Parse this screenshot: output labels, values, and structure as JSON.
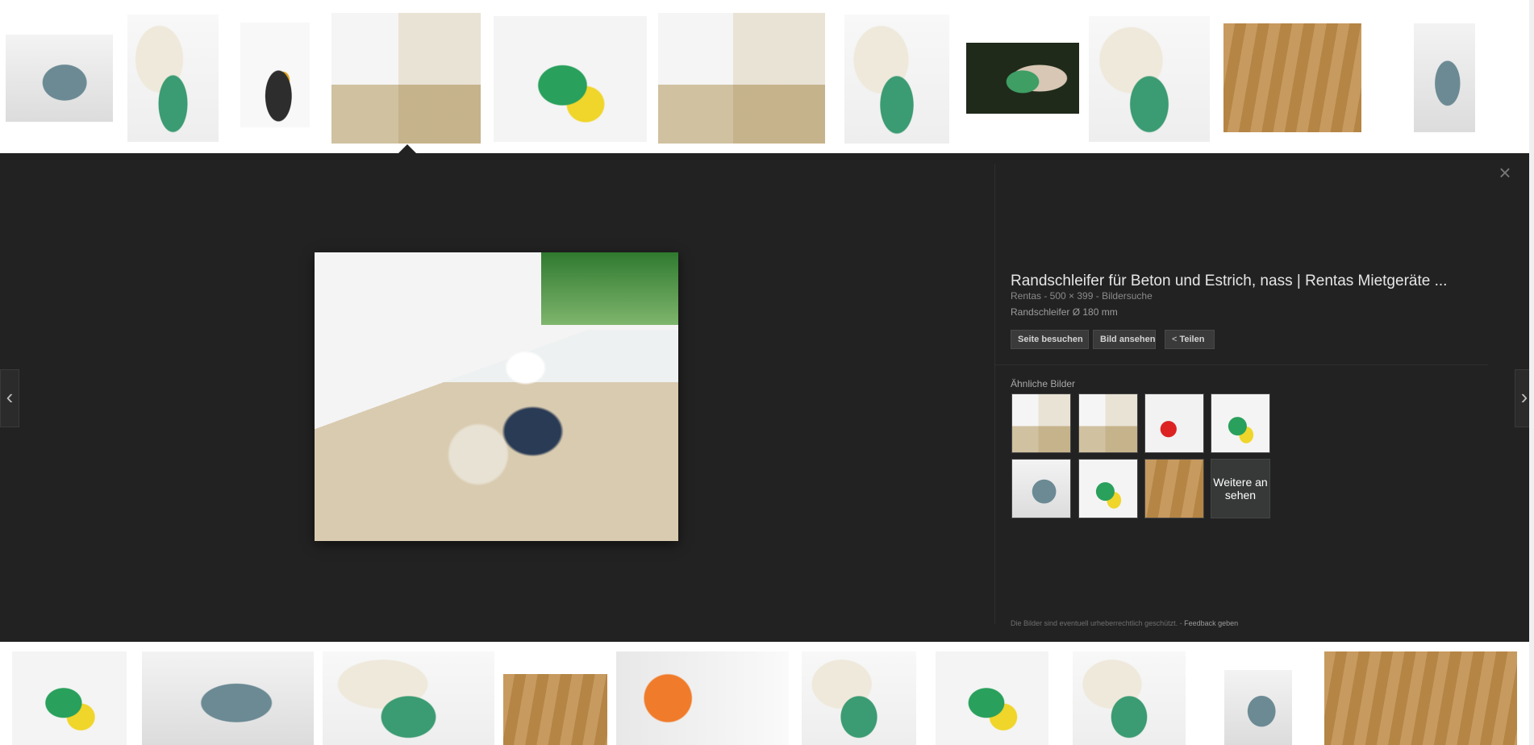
{
  "preview": {
    "title": "Randschleifer für Beton und Estrich, nass | Rentas Mietgeräte ...",
    "meta": "Rentas - 500 × 399 - Bildersuche",
    "description": "Randschleifer Ø 180 mm",
    "buttons": {
      "visit": "Seite besuchen",
      "view": "Bild ansehen",
      "share": "Teilen"
    },
    "similar_label": "Ähnliche Bilder",
    "more_label": "Weitere ansehen",
    "footer_text": "Die Bilder sind eventuell urheberrechtlich geschützt.",
    "footer_sep": " - ",
    "feedback": "Feedback geben"
  },
  "icons": {
    "prev": "chevron-left-icon",
    "next": "chevron-right-icon",
    "close": "close-icon",
    "share": "share-icon"
  },
  "colors": {
    "panel": "#222222",
    "text": "#e6e6e6",
    "muted": "#8a8a8a"
  }
}
